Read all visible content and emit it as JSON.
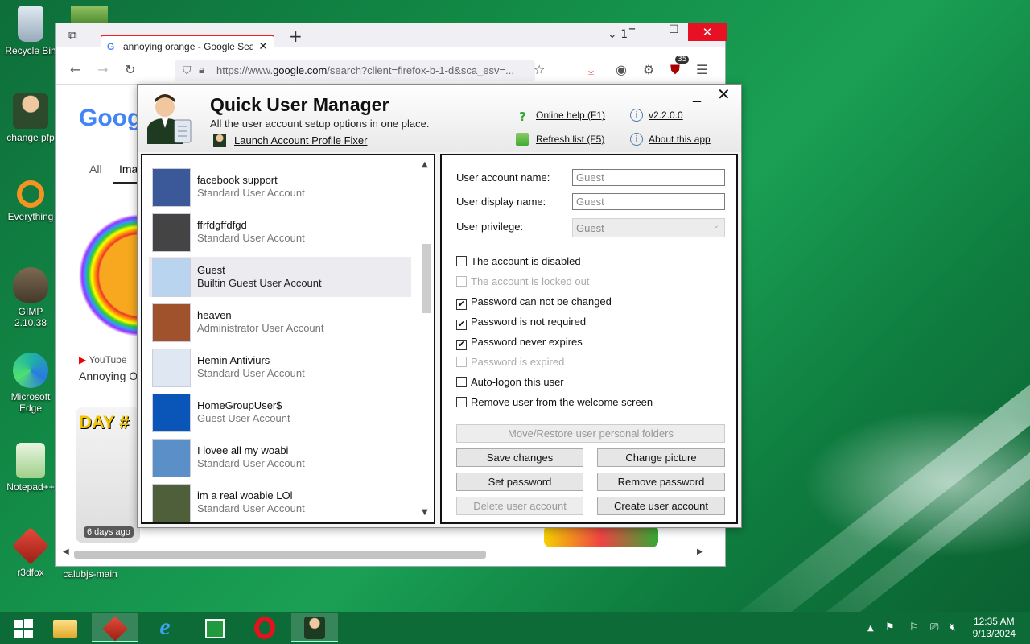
{
  "desktop": {
    "icons": [
      {
        "label": "Recycle Bin"
      },
      {
        "label": "change pfp"
      },
      {
        "label": "Everything"
      },
      {
        "label": "GIMP 2.10.38"
      },
      {
        "label": "Microsoft Edge"
      },
      {
        "label": "Notepad++"
      },
      {
        "label": "r3dfox"
      },
      {
        "label": "calubjs-main"
      }
    ]
  },
  "browser": {
    "tab_title": "annoying orange - Google Search",
    "url_prefix": "https://www.",
    "url_domain": "google.com",
    "url_rest": "/search?client=firefox-b-1-d&sca_esv=...",
    "tab_count": "1",
    "extension_badge": "35",
    "google_logo": "Goog",
    "nav_all": "All",
    "nav_images": "Ima",
    "result_source": "YouTube",
    "result_title": "Annoying O",
    "thumb_caption": "6 days ago",
    "thumb_text": "DAY #"
  },
  "app": {
    "title": "Quick User Manager",
    "subtitle": "All the user account setup options in one place.",
    "launch_link": "Launch Account Profile Fixer",
    "online_help": "Online help (F1)",
    "refresh_list": "Refresh list (F5)",
    "version": "v2.2.0.0",
    "about": "About this app",
    "users": [
      {
        "name": "facebook support",
        "type": "Standard User Account",
        "color": "#3b5998"
      },
      {
        "name": "ffrfdgffdfgd",
        "type": "Standard User Account",
        "color": "#444444"
      },
      {
        "name": "Guest",
        "type": "Builtin Guest User Account",
        "color": "#b8d4ee"
      },
      {
        "name": "heaven",
        "type": "Administrator User Account",
        "color": "#a0522d"
      },
      {
        "name": "Hemin Antiviurs",
        "type": "Standard User Account",
        "color": "#dfe8f2"
      },
      {
        "name": "HomeGroupUser$",
        "type": "Guest User Account",
        "color": "#0a56b8"
      },
      {
        "name": "I lovee all my woabi",
        "type": "Standard User Account",
        "color": "#5a8fc8"
      },
      {
        "name": "im a real woabie LOl",
        "type": "Standard User Account",
        "color": "#4e5f3a"
      }
    ],
    "selected_user_index": 2,
    "fields": {
      "account_name_label": "User account name:",
      "account_name_value": "Guest",
      "display_name_label": "User display name:",
      "display_name_value": "Guest",
      "privilege_label": "User privilege:",
      "privilege_value": "Guest"
    },
    "checkboxes": [
      {
        "label": "The account is disabled",
        "checked": false,
        "disabled": false
      },
      {
        "label": "The account is locked out",
        "checked": false,
        "disabled": true
      },
      {
        "label": "Password can not be changed",
        "checked": true,
        "disabled": false
      },
      {
        "label": "Password is not required",
        "checked": true,
        "disabled": false
      },
      {
        "label": "Password never expires",
        "checked": true,
        "disabled": false
      },
      {
        "label": "Password is expired",
        "checked": false,
        "disabled": true
      },
      {
        "label": "Auto-logon this user",
        "checked": false,
        "disabled": false
      },
      {
        "label": "Remove user from the welcome screen",
        "checked": false,
        "disabled": false
      }
    ],
    "buttons": {
      "move_restore": "Move/Restore user personal folders",
      "save": "Save changes",
      "change_picture": "Change picture",
      "set_password": "Set password",
      "remove_password": "Remove password",
      "delete_user": "Delete user account",
      "create_user": "Create user account"
    }
  },
  "taskbar": {
    "time": "12:35 AM",
    "date": "9/13/2024"
  }
}
